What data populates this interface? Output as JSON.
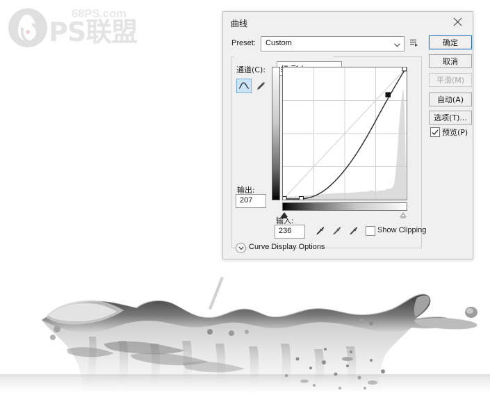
{
  "watermark": {
    "domain": "68PS.com",
    "brand": "PS联盟",
    "mark_icon": "flame-droplet-icon"
  },
  "dialog": {
    "title": "曲线",
    "close_icon": "close-icon",
    "preset": {
      "label": "Preset:",
      "value": "Custom",
      "chevron_icon": "chevron-down-icon",
      "menu_icon": "preset-menu-icon"
    },
    "channel": {
      "label": "通道(C):",
      "value": "红 副本",
      "chevron_icon": "chevron-down-icon"
    },
    "tools": {
      "curve_icon": "curve-tool-icon",
      "pencil_icon": "pencil-tool-icon"
    },
    "output": {
      "label": "输出:",
      "value": "207"
    },
    "input": {
      "label": "输入:",
      "value": "236"
    },
    "eyedroppers": {
      "black_icon": "eyedropper-black-point-icon",
      "gray_icon": "eyedropper-gray-point-icon",
      "white_icon": "eyedropper-white-point-icon"
    },
    "show_clipping": {
      "label": "Show Clipping",
      "checked": false
    },
    "curve_display_options": {
      "label": "Curve Display Options",
      "toggle_icon": "chevron-down-icon",
      "expanded": false
    },
    "buttons": {
      "ok": "确定",
      "cancel": "取消",
      "smooth": "平滑(M)",
      "auto": "自动(A)",
      "options": "选项(T)..."
    },
    "preview": {
      "label": "预览(P)",
      "checked": true,
      "check_icon": "check-icon"
    },
    "colors": {
      "dialog_bg": "#f0f0f0",
      "accent": "#2a6fb5",
      "tool_selected_bg": "#cce4f7",
      "field_border": "#9b9b9b"
    }
  },
  "chart_data": {
    "type": "line",
    "title": "曲线",
    "xlabel": "输入",
    "ylabel": "输出",
    "xlim": [
      0,
      255
    ],
    "ylim": [
      0,
      255
    ],
    "grid": true,
    "grid_divisions": 4,
    "series": [
      {
        "name": "baseline",
        "points": [
          [
            0,
            0
          ],
          [
            255,
            255
          ]
        ]
      },
      {
        "name": "红 副本",
        "control_points": [
          [
            0,
            0
          ],
          [
            38,
            0
          ],
          [
            217,
            207
          ],
          [
            255,
            255
          ]
        ],
        "points": [
          [
            0,
            0
          ],
          [
            20,
            0
          ],
          [
            38,
            0
          ],
          [
            64,
            6
          ],
          [
            90,
            19
          ],
          [
            115,
            38
          ],
          [
            140,
            63
          ],
          [
            165,
            95
          ],
          [
            190,
            135
          ],
          [
            217,
            184
          ],
          [
            236,
            222
          ],
          [
            255,
            255
          ]
        ]
      }
    ],
    "selected_point": {
      "input": 236,
      "output": 207
    },
    "histogram_note": "light gray histogram, low across midtones with tall spike at highlight end"
  },
  "photo": {
    "alt": "grayscale water splash"
  }
}
